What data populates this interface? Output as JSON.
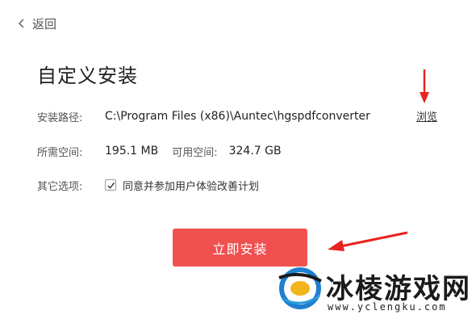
{
  "header": {
    "back_label": "返回"
  },
  "title": "自定义安装",
  "install_path": {
    "label": "安装路径:",
    "value": "C:\\Program Files (x86)\\Auntec\\hgspdfconverter",
    "browse_label": "浏览"
  },
  "space": {
    "required_label": "所需空间:",
    "required_value": "195.1 MB",
    "available_label": "可用空间:",
    "available_value": "324.7 GB"
  },
  "options": {
    "label": "其它选项:",
    "checkbox_text": "同意并参加用户体验改善计划",
    "checked": true
  },
  "install_button": "立即安装",
  "watermark": {
    "text": "冰棱游戏网",
    "url": "www.yclengku.com"
  },
  "colors": {
    "accent": "#f05050",
    "annotation_red": "#e8231f"
  }
}
